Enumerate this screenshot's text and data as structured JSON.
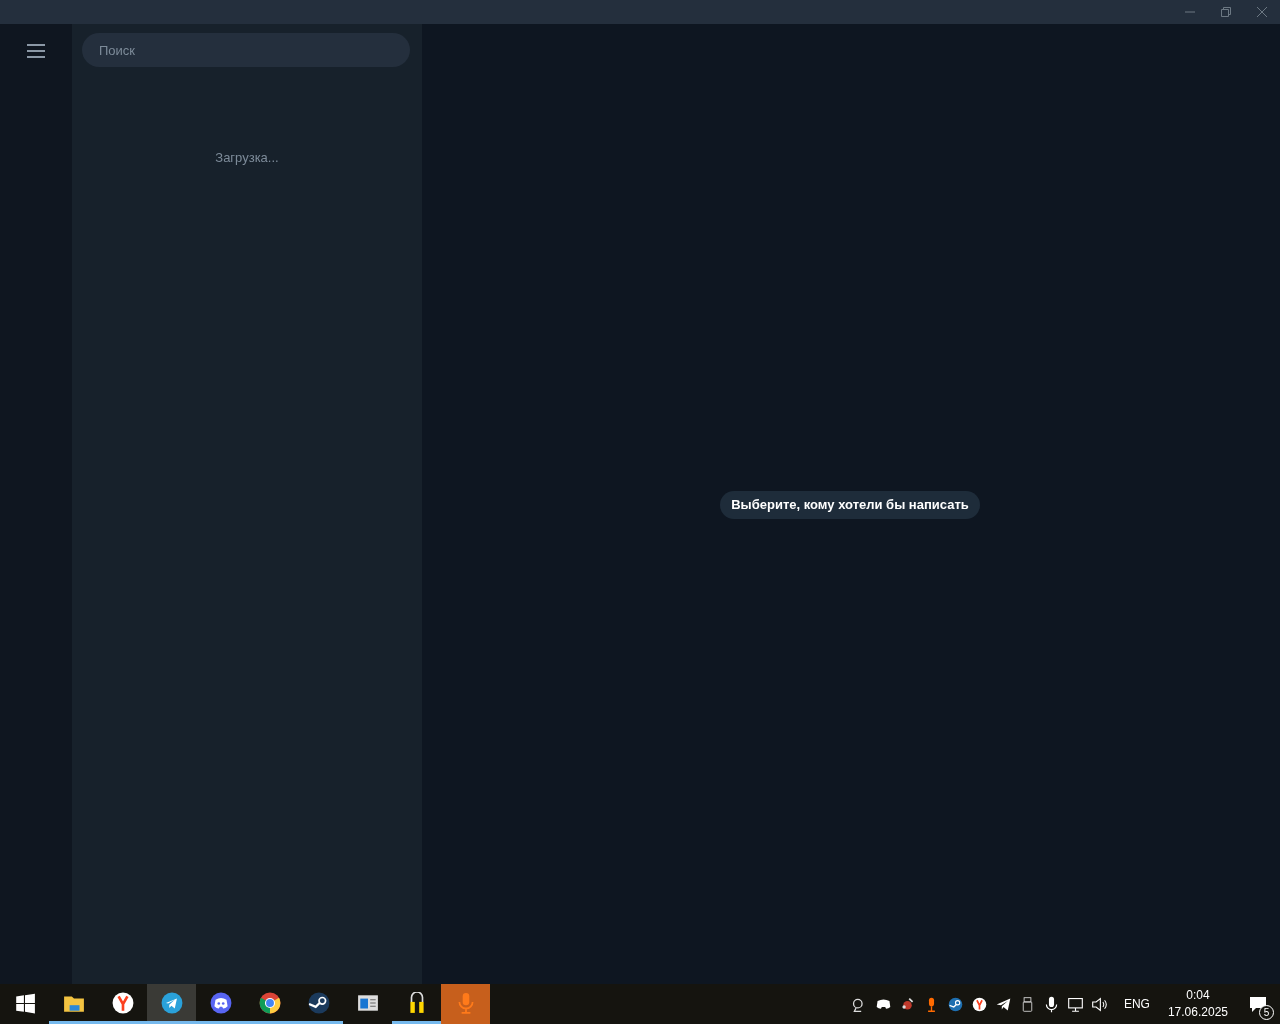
{
  "window": {
    "controls": [
      {
        "kind": "minimize"
      },
      {
        "kind": "restore"
      },
      {
        "kind": "close"
      }
    ]
  },
  "search": {
    "placeholder": "Поиск"
  },
  "chat_list": {
    "status": "Загрузка..."
  },
  "main": {
    "hint": "Выберите, кому хотели бы написать"
  },
  "taskbar": {
    "apps": [
      {
        "kind": "start",
        "running": false,
        "active": false
      },
      {
        "kind": "folder",
        "running": true,
        "active": false
      },
      {
        "kind": "browser-y",
        "running": true,
        "active": false
      },
      {
        "kind": "telegram",
        "running": true,
        "active": true
      },
      {
        "kind": "discord",
        "running": true,
        "active": false
      },
      {
        "kind": "chrome",
        "running": true,
        "active": false
      },
      {
        "kind": "steam",
        "running": true,
        "active": false
      },
      {
        "kind": "window",
        "running": false,
        "active": false
      },
      {
        "kind": "lock",
        "running": true,
        "active": false
      },
      {
        "kind": "mic",
        "running": false,
        "active": true
      }
    ],
    "tray": [
      {
        "kind": "satellite"
      },
      {
        "kind": "discord"
      },
      {
        "kind": "paint"
      },
      {
        "kind": "mic"
      },
      {
        "kind": "steam"
      },
      {
        "kind": "browser-y"
      },
      {
        "kind": "telegram"
      },
      {
        "kind": "usb"
      },
      {
        "kind": "microphone"
      },
      {
        "kind": "network"
      },
      {
        "kind": "volume"
      }
    ],
    "language": "ENG",
    "time": "0:04",
    "date": "17.06.2025",
    "notifications": "5"
  }
}
